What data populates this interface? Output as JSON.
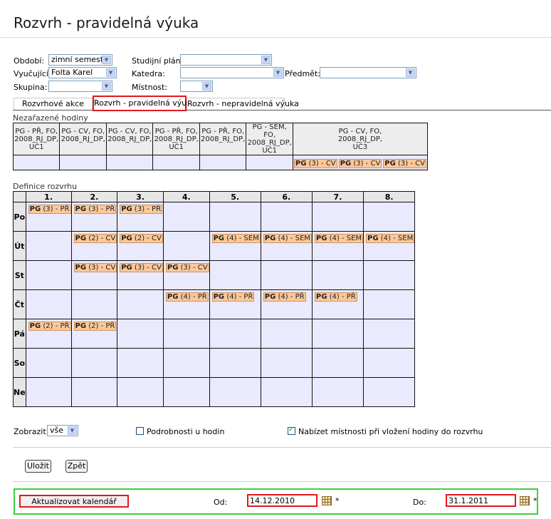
{
  "page_title": "Rozvrh - pravidelná výuka",
  "filters": {
    "obdobi": {
      "label": "Období:",
      "value": "zimní semestr"
    },
    "vyucujici": {
      "label": "Vyučující:",
      "value": "Folta Karel"
    },
    "skupina": {
      "label": "Skupina:",
      "value": ""
    },
    "studijni_plan": {
      "label": "Studijní plán:",
      "value": ""
    },
    "katedra": {
      "label": "Katedra:",
      "value": ""
    },
    "mistnost": {
      "label": "Místnost:",
      "value": ""
    },
    "predmet": {
      "label": "Předmět:",
      "value": ""
    }
  },
  "tabs": [
    {
      "label": "Rozvrhové akce"
    },
    {
      "label": "Rozvrh - pravidelná výuka"
    },
    {
      "label": "Rozvrh - nepravidelná výuka"
    }
  ],
  "unassigned": {
    "label": "Nezařazené hodiny",
    "columns": [
      [
        "PG - PŘ, FO,",
        "2008_RJ_DP,",
        "UČ1"
      ],
      [
        "PG - CV, FO,",
        "2008_RJ_DP,",
        ""
      ],
      [
        "PG - CV, FO,",
        "2008_RJ_DP,",
        ""
      ],
      [
        "PG - PŘ, FO,",
        "2008_RJ_DP,",
        "UČ1"
      ],
      [
        "PG - PŘ, FO,",
        "2008_RJ_DP,",
        ""
      ],
      [
        "PG - SEM, FO,",
        "2008_RJ_DP,",
        "UČ1"
      ],
      [
        "PG - CV, FO,",
        "2008_RJ_DP,",
        "UČ3"
      ]
    ],
    "chips": [
      {
        "b": "PG",
        "t": " (3) - CV"
      },
      {
        "b": "PG",
        "t": " (3) - CV"
      },
      {
        "b": "PG",
        "t": " (3) - CV"
      }
    ]
  },
  "timetable": {
    "label": "Definice rozvrhu",
    "periods": [
      "1.",
      "2.",
      "3.",
      "4.",
      "5.",
      "6.",
      "7.",
      "8."
    ],
    "days": [
      {
        "name": "Po",
        "cells": [
          {
            "b": "PG",
            "t": " (3) - PŘ"
          },
          {
            "b": "PG",
            "t": " (3) - PŘ"
          },
          {
            "b": "PG",
            "t": " (3) - PŘ"
          },
          null,
          null,
          null,
          null,
          null
        ]
      },
      {
        "name": "Út",
        "cells": [
          null,
          {
            "b": "PG",
            "t": " (2) - CV"
          },
          {
            "b": "PG",
            "t": " (2) - CV"
          },
          null,
          {
            "b": "PG",
            "t": " (4) - SEM"
          },
          {
            "b": "PG",
            "t": " (4) - SEM"
          },
          {
            "b": "PG",
            "t": " (4) - SEM"
          },
          {
            "b": "PG",
            "t": " (4) - SEM"
          }
        ]
      },
      {
        "name": "St",
        "cells": [
          null,
          {
            "b": "PG",
            "t": " (3) - CV"
          },
          {
            "b": "PG",
            "t": " (3) - CV"
          },
          {
            "b": "PG",
            "t": " (3) - CV"
          },
          null,
          null,
          null,
          null
        ]
      },
      {
        "name": "Čt",
        "cells": [
          null,
          null,
          null,
          {
            "b": "PG",
            "t": " (4) - PŘ"
          },
          {
            "b": "PG",
            "t": " (4) - PŘ"
          },
          {
            "b": "PG",
            "t": " (4) - PŘ"
          },
          {
            "b": "PG",
            "t": " (4) - PŘ"
          },
          null
        ]
      },
      {
        "name": "Pá",
        "cells": [
          {
            "b": "PG",
            "t": " (2) - PŘ"
          },
          {
            "b": "PG",
            "t": " (2) - PŘ"
          },
          null,
          null,
          null,
          null,
          null,
          null
        ]
      },
      {
        "name": "So",
        "cells": [
          null,
          null,
          null,
          null,
          null,
          null,
          null,
          null
        ]
      },
      {
        "name": "Ne",
        "cells": [
          null,
          null,
          null,
          null,
          null,
          null,
          null,
          null
        ]
      }
    ]
  },
  "display": {
    "zobrazit_label": "Zobrazit:",
    "zobrazit_value": "vše",
    "details_label": "Podrobnosti u hodin",
    "details_checked": false,
    "rooms_label": "Nabízet místnosti při vložení hodiny do rozvrhu",
    "rooms_checked": true
  },
  "buttons": {
    "save": "Uložit",
    "back": "Zpět",
    "update_calendar": "Aktualizovat kalendář"
  },
  "dates": {
    "from_label": "Od:",
    "from_value": "14.12.2010",
    "to_label": "Do:",
    "to_value": "31.1.2011",
    "required_mark": "*"
  },
  "colors": {
    "chip_bg": "#fcc89a",
    "cell_bg": "#eaeaff",
    "highlight_red": "#e0181e",
    "highlight_green": "#3ecf3e"
  }
}
